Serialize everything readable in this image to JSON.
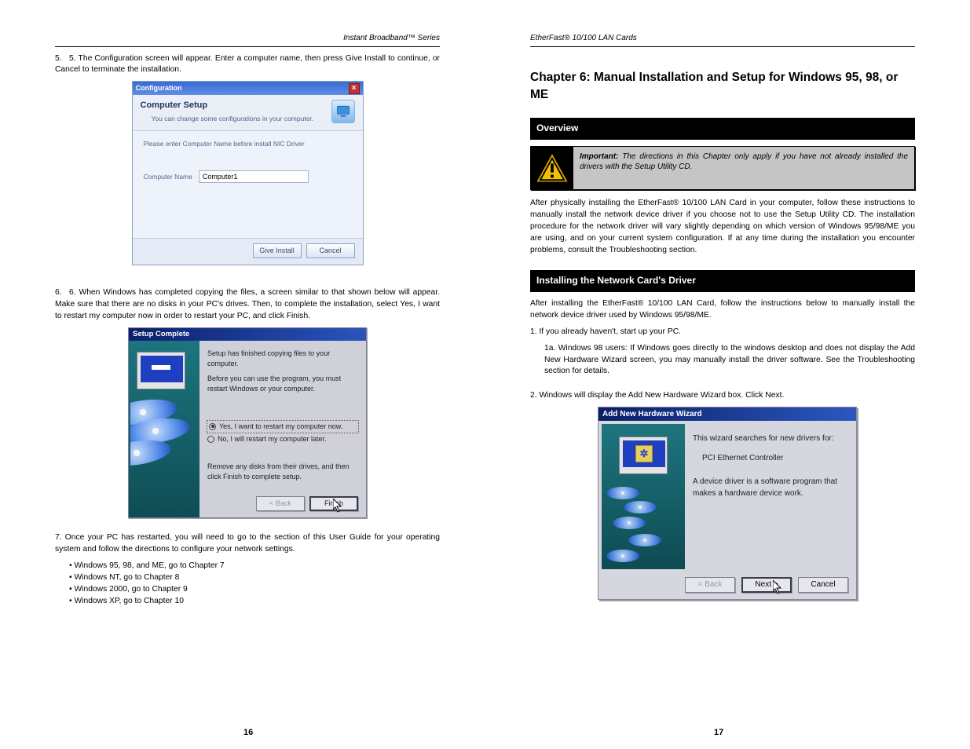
{
  "left": {
    "header_product": "Instant Broadband™ Series",
    "step5": "5. The Configuration screen will appear. Enter a computer name, then press Give Install to continue, or Cancel to terminate the installation.",
    "step6": "6. When Windows has completed copying the files, a screen similar to that shown below will appear. Make sure that there are no disks in your PC's drives. Then, to complete the installation, select Yes, I want to restart my computer now in order to restart your PC, and click Finish.",
    "step7_intro": "7.   Once your PC has restarted, you will need to go to the section of this User Guide for your operating system and follow the directions to configure your network settings.",
    "os_list": [
      "• Windows 95, 98, and ME, go to Chapter 7",
      "• Windows NT, go to Chapter 8",
      "• Windows 2000, go to Chapter 9",
      "• Windows XP, go to Chapter 10"
    ],
    "fig1": {
      "titlebar": "Configuration",
      "close": "×",
      "heading": "Computer Setup",
      "sub": "You can change some configurations in your computer.",
      "prompt": "Please enter Computer Name before install NIC Driver",
      "label": "Computer Name",
      "value": "Computer1",
      "btn_install": "Give Install",
      "btn_cancel": "Cancel"
    },
    "fig2": {
      "titlebar": "Setup Complete",
      "p1": "Setup has finished copying files to your computer.",
      "p2": "Before you can use the program, you must restart Windows or your computer.",
      "opt_yes": "Yes, I want to restart my computer now.",
      "opt_no": "No, I will restart my computer later.",
      "p3": "Remove any disks from their drives, and then click Finish to complete setup.",
      "btn_back": "< Back",
      "btn_finish": "Finish"
    },
    "page": "16"
  },
  "right": {
    "header_product": "EtherFast® 10/100 LAN Cards",
    "chapter_title": "Chapter 6: Manual Installation and Setup for Windows 95, 98, or ME",
    "section1": "Overview",
    "important_label": "Important:",
    "important_text": "The directions in this Chapter only apply if you have not already installed the drivers with the Setup Utility CD.",
    "p1": "After physically installing the EtherFast® 10/100 LAN Card in your computer, follow these instructions to manually install the network device driver if you choose not to use the Setup Utility CD. The installation procedure for the network driver will vary slightly depending on which version of Windows 95/98/ME you are using, and on your current system configuration. If at any time during the installation you encounter problems, consult the Troubleshooting section.",
    "section2": "Installing the Network Card's Driver",
    "p2": "After installing the EtherFast® 10/100 LAN Card, follow the instructions below to manually install the network device driver used by Windows 95/98/ME.",
    "step1a": "1.   If you already haven't, start up your PC.",
    "step1b": "1a. Windows 98 users: If Windows goes directly to the windows desktop and does not display the Add New Hardware Wizard screen, you may manually install the driver software. See the Troubleshooting section for details.",
    "step2": "2.   Windows will display the Add New Hardware Wizard box. Click Next.",
    "fig3": {
      "titlebar": "Add New Hardware Wizard",
      "p1": "This wizard searches for new drivers for:",
      "p2": "PCI Ethernet Controller",
      "p3": "A device driver is a software program that makes a hardware device work.",
      "btn_back": "< Back",
      "btn_next": "Next >",
      "btn_cancel": "Cancel"
    },
    "page": "17"
  }
}
